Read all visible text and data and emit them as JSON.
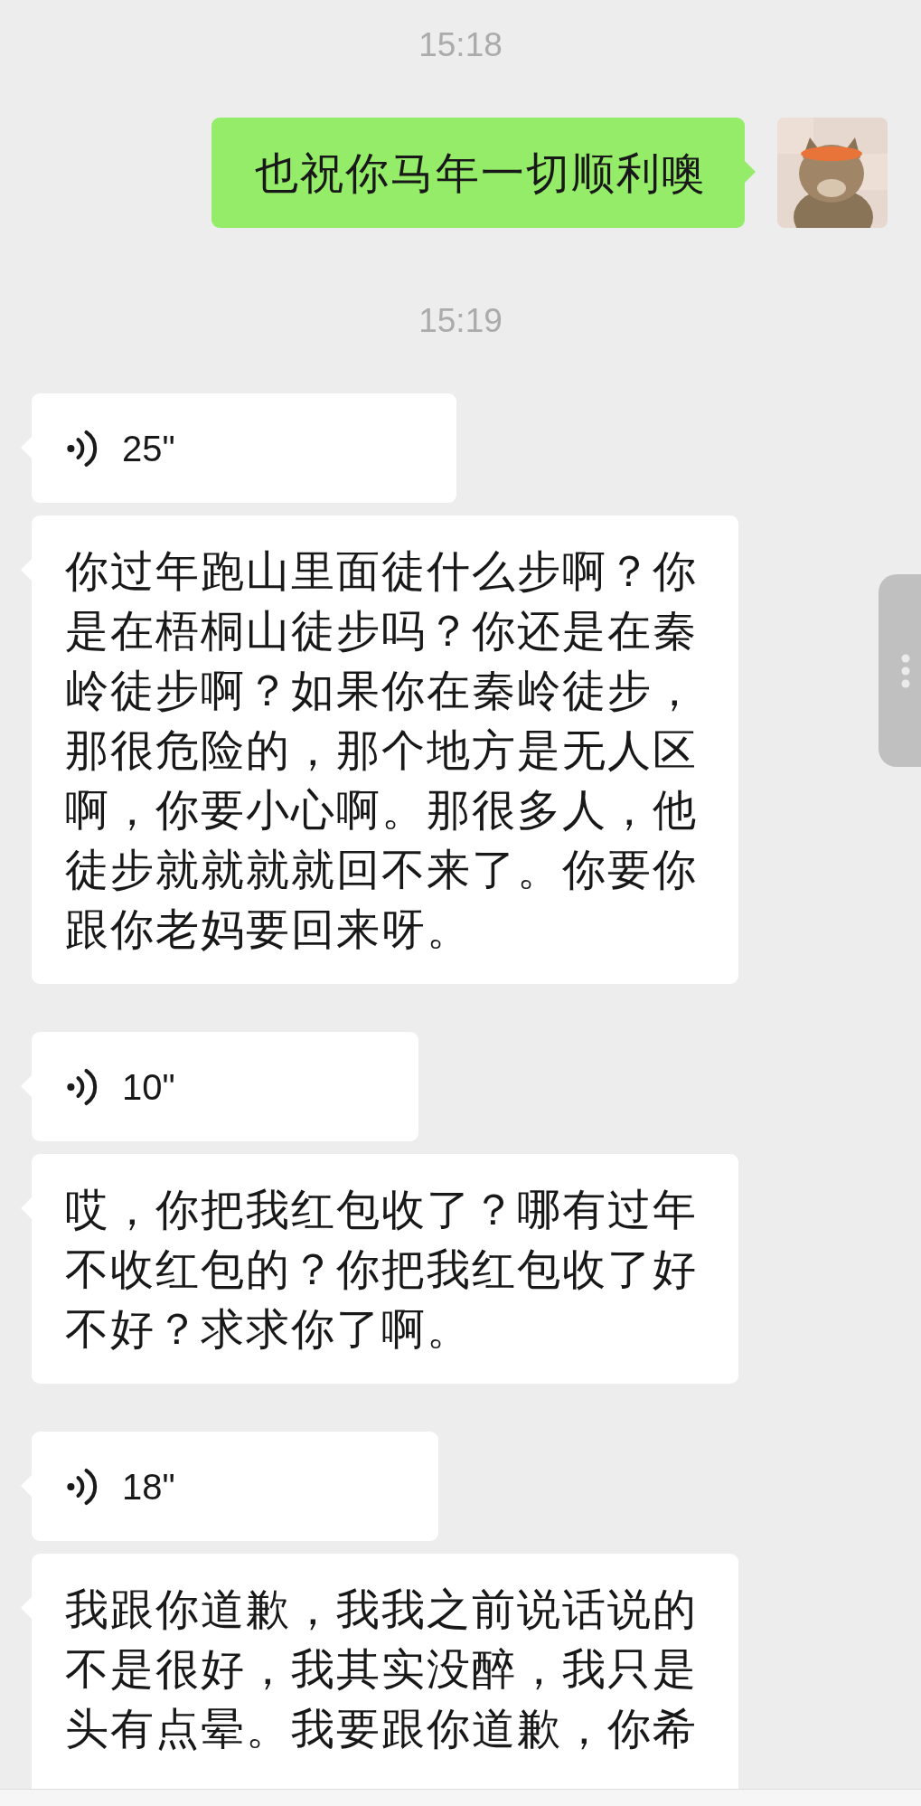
{
  "messages": [
    {
      "kind": "time",
      "text": "15:18"
    },
    {
      "kind": "sent_text",
      "text": "也祝你马年一切顺利噢"
    },
    {
      "kind": "time",
      "text": "15:19"
    },
    {
      "kind": "voice",
      "duration": "25\""
    },
    {
      "kind": "text",
      "text": "你过年跑山里面徒什么步啊？你是在梧桐山徒步吗？你还是在秦岭徒步啊？如果你在秦岭徒步，那很危险的，那个地方是无人区啊，你要小心啊。那很多人，他徒步就就就就回不来了。你要你跟你老妈要回来呀。"
    },
    {
      "kind": "voice",
      "duration": "10\""
    },
    {
      "kind": "text",
      "text": "哎，你把我红包收了？哪有过年不收红包的？你把我红包收了好不好？求求你了啊。"
    },
    {
      "kind": "voice",
      "duration": "18\""
    },
    {
      "kind": "text",
      "text": "我跟你道歉，我我之前说话说的不是很好，我其实没醉，我只是头有点晕。我要跟你道歉，你希"
    }
  ]
}
